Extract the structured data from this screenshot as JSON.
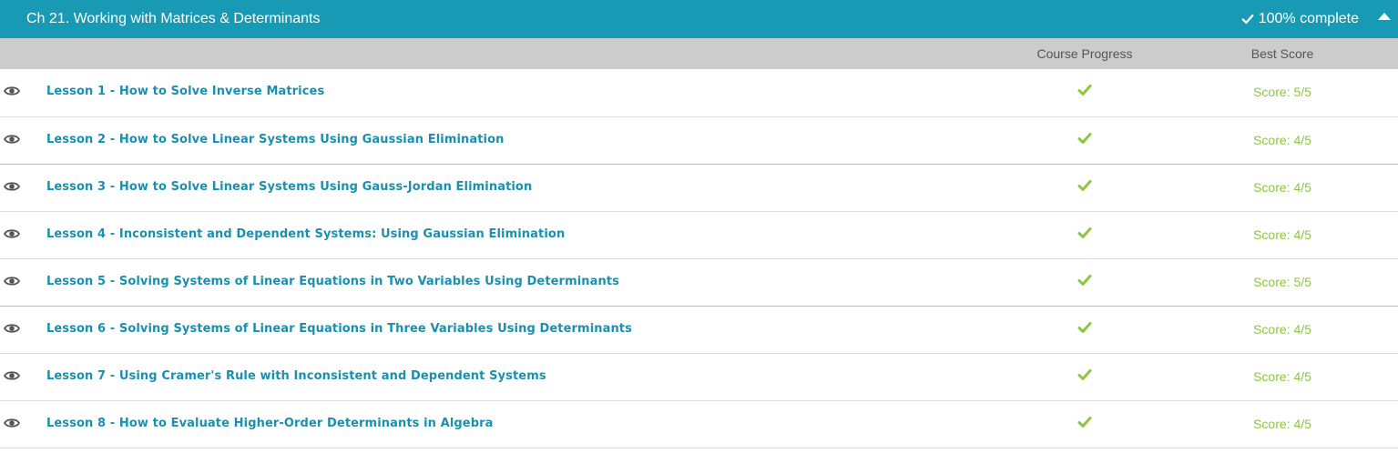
{
  "chapter": {
    "title": "Ch 21. Working with Matrices & Determinants",
    "completion_label": "100% complete",
    "header_color": "#1899b4"
  },
  "columns": {
    "progress": "Course Progress",
    "score": "Best Score"
  },
  "icons": {
    "view": "eye-icon",
    "complete": "check-icon",
    "collapse": "caret-up-icon"
  },
  "colors": {
    "link": "#1a8fb0",
    "success": "#8cc63f"
  },
  "lessons": [
    {
      "label": "Lesson 1 - How to Solve Inverse Matrices",
      "completed": true,
      "score": "Score: 5/5"
    },
    {
      "label": "Lesson 2 - How to Solve Linear Systems Using Gaussian Elimination",
      "completed": true,
      "score": "Score: 4/5"
    },
    {
      "label": "Lesson 3 - How to Solve Linear Systems Using Gauss-Jordan Elimination",
      "completed": true,
      "score": "Score: 4/5"
    },
    {
      "label": "Lesson 4 - Inconsistent and Dependent Systems: Using Gaussian Elimination",
      "completed": true,
      "score": "Score: 4/5"
    },
    {
      "label": "Lesson 5 - Solving Systems of Linear Equations in Two Variables Using Determinants",
      "completed": true,
      "score": "Score: 5/5"
    },
    {
      "label": "Lesson 6 - Solving Systems of Linear Equations in Three Variables Using Determinants",
      "completed": true,
      "score": "Score: 4/5"
    },
    {
      "label": "Lesson 7 - Using Cramer's Rule with Inconsistent and Dependent Systems",
      "completed": true,
      "score": "Score: 4/5"
    },
    {
      "label": "Lesson 8 - How to Evaluate Higher-Order Determinants in Algebra",
      "completed": true,
      "score": "Score: 4/5"
    }
  ]
}
